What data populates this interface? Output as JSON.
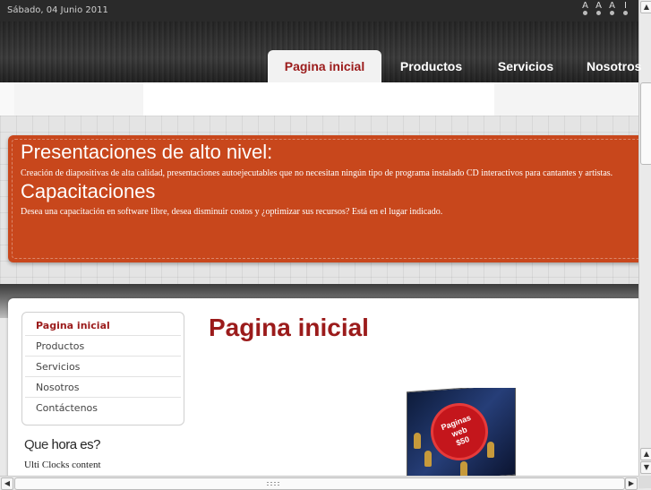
{
  "header": {
    "date": "Sábado, 04 Junio 2011",
    "font_size_controls": [
      "A",
      "A",
      "A",
      "I"
    ]
  },
  "nav": {
    "tabs": [
      {
        "label": "Pagina inicial",
        "active": true
      },
      {
        "label": "Productos",
        "active": false
      },
      {
        "label": "Servicios",
        "active": false
      },
      {
        "label": "Nosotros",
        "active": false
      }
    ]
  },
  "hero": {
    "heading1": "Presentaciones de alto nivel:",
    "text1": "Creación de diapositivas de alta calidad, presentaciones autoejecutables que no necesitan ningún tipo de programa instalado CD interactivos para cantantes y artistas.",
    "heading2": "Capacitaciones",
    "text2": "Desea una capacitación en software libre, desea disminuir costos y ¿optimizar sus recursos? Está en el lugar indicado.",
    "color": "#c8471c"
  },
  "sidebar": {
    "items": [
      {
        "label": "Pagina inicial",
        "active": true
      },
      {
        "label": "Productos",
        "active": false
      },
      {
        "label": "Servicios",
        "active": false
      },
      {
        "label": "Nosotros",
        "active": false
      },
      {
        "label": "Contáctenos",
        "active": false
      }
    ],
    "clock_title_light": "Que",
    "clock_title_bold": "hora es?",
    "clock_content": "Ulti Clocks content"
  },
  "main": {
    "title": "Pagina inicial",
    "promo_badge": [
      "Paginas",
      "web",
      "$50"
    ]
  },
  "colors": {
    "accent": "#9b1b1b",
    "hero": "#c8471c",
    "nav_bg": "#2c2c2c"
  }
}
